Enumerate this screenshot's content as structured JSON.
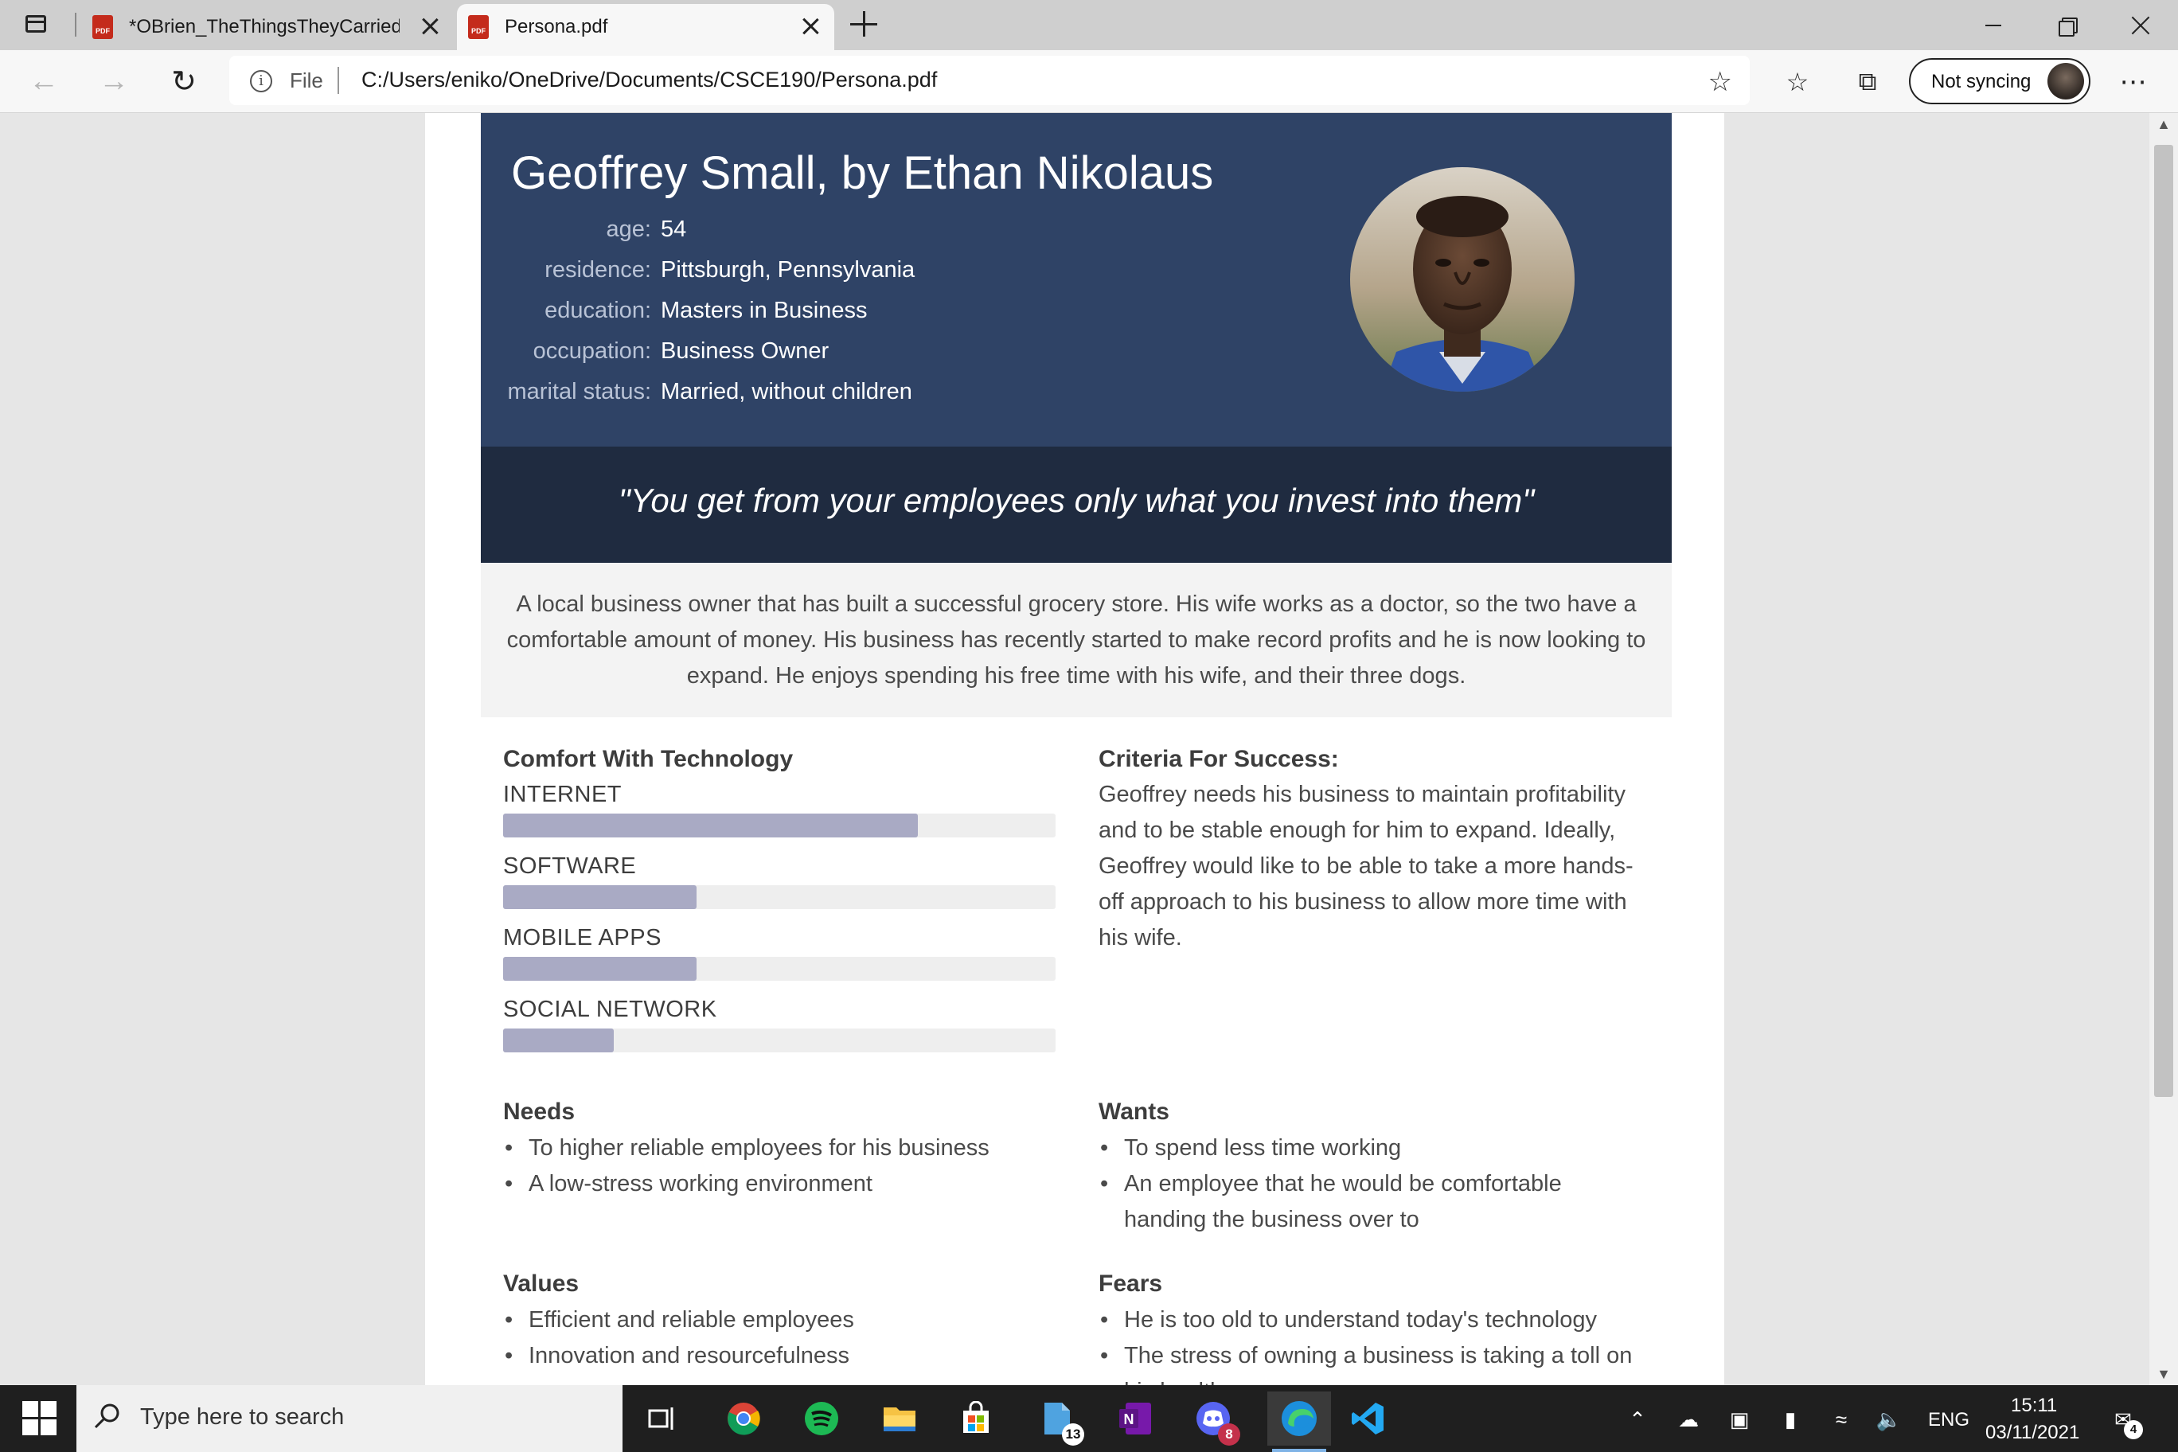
{
  "browser": {
    "tabs": [
      {
        "title": "*OBrien_TheThingsTheyCarried.p",
        "active": false
      },
      {
        "title": "Persona.pdf",
        "active": true
      }
    ],
    "address": {
      "scheme_label": "File",
      "url": "C:/Users/eniko/OneDrive/Documents/CSCE190/Persona.pdf"
    },
    "profile": {
      "label": "Not syncing"
    }
  },
  "persona": {
    "title": "Geoffrey Small, by Ethan Nikolaus",
    "facts": [
      {
        "label": "age:",
        "value": "54"
      },
      {
        "label": "residence:",
        "value": "Pittsburgh, Pennsylvania"
      },
      {
        "label": "education:",
        "value": "Masters in Business"
      },
      {
        "label": "occupation:",
        "value": "Business Owner"
      },
      {
        "label": "marital status:",
        "value": "Married, without children"
      }
    ],
    "quote": "\"You get from your employees only what you invest into them\"",
    "summary": "A local business owner that has built a successful grocery store. His wife works as a doctor, so the two have a comfortable amount of money. His business has recently started to make record profits and he is now looking to expand. He enjoys spending his free time with his wife, and their three dogs.",
    "tech": {
      "heading": "Comfort With Technology",
      "skills": [
        {
          "label": "INTERNET",
          "level": 0.75
        },
        {
          "label": "SOFTWARE",
          "level": 0.35
        },
        {
          "label": "MOBILE APPS",
          "level": 0.35
        },
        {
          "label": "SOCIAL NETWORK",
          "level": 0.2
        }
      ]
    },
    "criteria": {
      "heading": "Criteria For Success:",
      "text": "Geoffrey needs his business to maintain profitability and to be stable enough for him to expand. Ideally, Geoffrey would like to be able to take a more hands-off approach to his business to allow more time with his wife."
    },
    "needs": {
      "heading": "Needs",
      "items": [
        "To higher reliable employees for his business",
        "A low-stress working environment"
      ]
    },
    "wants": {
      "heading": "Wants",
      "items": [
        "To spend less time working",
        "An employee that he would be comfortable handing the business over to"
      ]
    },
    "values": {
      "heading": "Values",
      "items": [
        "Efficient and reliable employees",
        "Innovation and resourcefulness"
      ]
    },
    "fears": {
      "heading": "Fears",
      "items": [
        "He is too old to understand today's technology",
        "The stress of owning a business is taking a toll on his health"
      ]
    }
  },
  "taskbar": {
    "search_placeholder": "Type here to search",
    "badges": {
      "files": "13",
      "discord": "8"
    },
    "lang": "ENG",
    "time": "15:11",
    "date": "03/11/2021",
    "notifications": "4"
  },
  "colors": {
    "hero": "#2f4366",
    "quote_band": "#1f2b40",
    "bar_fill": "#a9aac4",
    "bar_track": "#eeeeee"
  }
}
